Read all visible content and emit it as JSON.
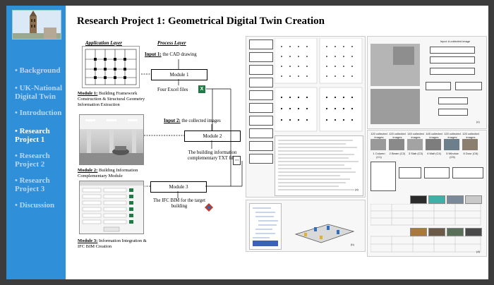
{
  "slide": {
    "title": "Research Project 1: Geometrical Digital Twin Creation"
  },
  "sidebar": {
    "items": [
      {
        "label": "Background",
        "active": false
      },
      {
        "label": "UK-National Digital Twin",
        "active": false
      },
      {
        "label": "Introduction",
        "active": false
      },
      {
        "label": "Research Project 1",
        "active": true
      },
      {
        "label": "Research Project 2",
        "active": false
      },
      {
        "label": "Research Project 3",
        "active": false
      },
      {
        "label": "Discussion",
        "active": false
      }
    ]
  },
  "columns": {
    "application_layer": "Application Layer",
    "process_layer": "Process Layer"
  },
  "modules": {
    "m1_caption_bold": "Module 1:",
    "m1_caption": "Building Framework Construction & Structural Geometry Information Extraction",
    "m2_caption_bold": "Module 2:",
    "m2_caption": "Building Information Complementary Module",
    "m3_caption_bold": "Module 3:",
    "m3_caption": "Information Integration & IFC BIM Creation"
  },
  "process": {
    "input1_bold": "Input 1:",
    "input1": "the CAD drawing",
    "module1": "Module 1",
    "excel_files": "Four Excel files",
    "input2_bold": "Input 2:",
    "input2": "the collected images",
    "module2": "Module 2",
    "txt_files": "The building information complementary TXT files",
    "module3": "Module 3",
    "ifc_bim": "The IFC BIM for the target building"
  },
  "figures": {
    "fig_a_label": "(a)",
    "fig_b_label": "(b)",
    "fig_c_label": "(c)",
    "fig_d_label": "(d)",
    "flow_title": "Input: A collected image",
    "image_counts": [
      "120 collected images",
      "120 collected images",
      "140 collected images",
      "145 collected images",
      "120 collected images",
      "120 collected images"
    ],
    "classes": [
      "1 Column (C1)",
      "2 Beam (C2)",
      "3 Slab (C3)",
      "4 Wall (C4)",
      "5 Window (C5)",
      "6 Door (C6)"
    ]
  },
  "colors": {
    "sidebar_bg": "#2f8fd8",
    "sidebar_text": "#b9d6f2",
    "sidebar_active": "#ffffff",
    "excel_icon": "#1e7b45",
    "txt_icon": "#333333",
    "bim_icon": "#c0392b"
  }
}
